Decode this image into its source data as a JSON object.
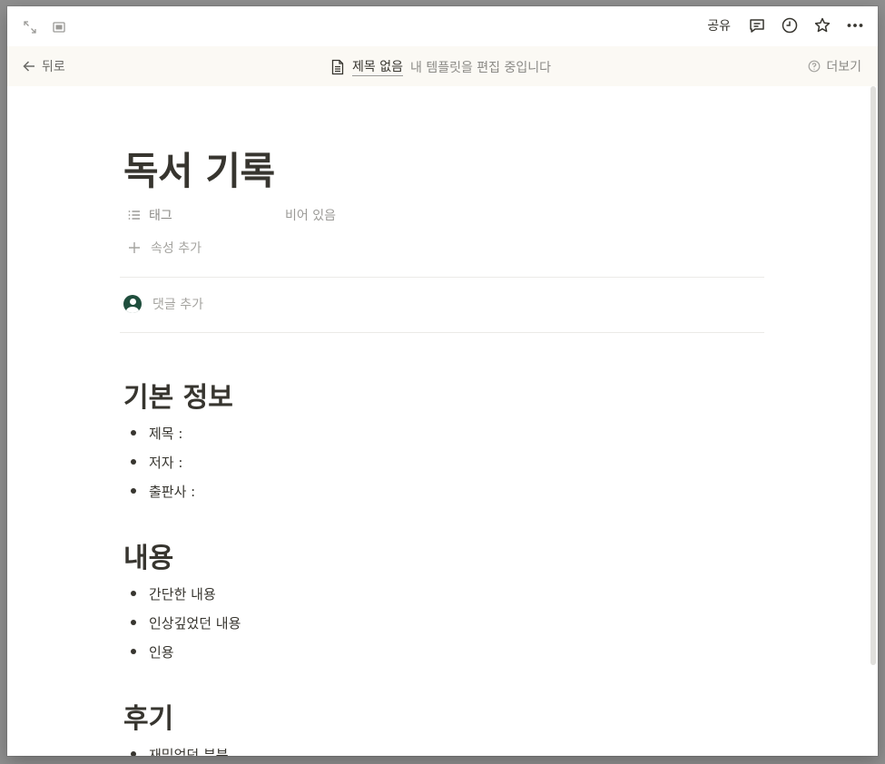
{
  "topbar": {
    "share_label": "공유",
    "icons": [
      "expand-icon",
      "peek-mode-icon",
      "comment-icon",
      "history-icon",
      "star-icon",
      "more-icon"
    ]
  },
  "banner": {
    "back_label": "뒤로",
    "page_link_label": "제목 없음",
    "note": "내 템플릿을 편집 중입니다",
    "learn_more_label": "더보기"
  },
  "page": {
    "title": "독서 기록",
    "properties": [
      {
        "name": "태그",
        "value": "비어 있음",
        "icon": "list-icon"
      }
    ],
    "add_property_label": "속성 추가",
    "add_comment_placeholder": "댓글 추가"
  },
  "sections": [
    {
      "heading": "기본 정보",
      "items": [
        "제목 :",
        "저자 :",
        "출판사 :"
      ]
    },
    {
      "heading": "내용",
      "items": [
        "간단한 내용",
        "인상깊었던 내용",
        "인용"
      ]
    },
    {
      "heading": "후기",
      "items": [
        "재밌었던 부분"
      ]
    }
  ],
  "colors": {
    "text": "#37352f",
    "banner_bg": "#fbf9f4",
    "muted": "#9b9a97",
    "avatar": "#1f4e3d"
  }
}
